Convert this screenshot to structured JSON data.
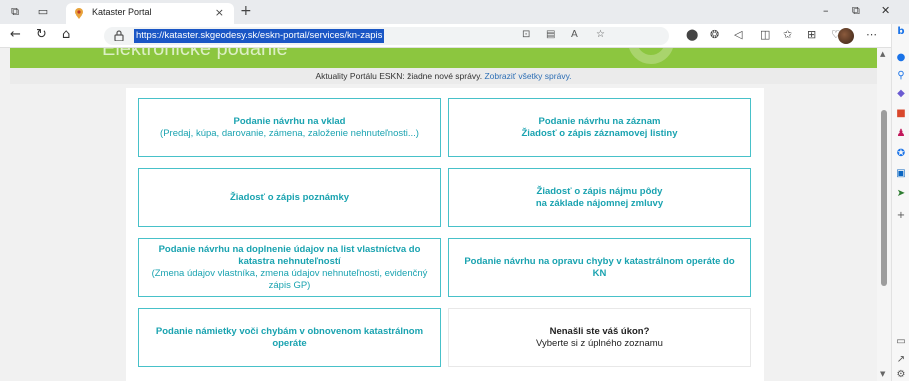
{
  "browser": {
    "tab_title": "Kataster Portal",
    "tab_close": "×",
    "new_tab": "+",
    "url": "https://kataster.skgeodesy.sk/eskn-portal/services/kn-zapis",
    "window_controls": [
      "–",
      "⧉",
      "✕"
    ]
  },
  "page": {
    "banner_title": "Elektronické podanie",
    "news_text": "Aktuality Portálu ESKN: žiadne nové správy.",
    "news_link": "Zobraziť všetky správy."
  },
  "services": {
    "s1_title": "Podanie návrhu na vklad",
    "s1_sub": "(Predaj, kúpa, darovanie, zámena, založenie nehnuteľnosti...)",
    "s2_line1": "Podanie návrhu na záznam",
    "s2_line2": "Žiadosť o zápis záznamovej listiny",
    "s3_title": "Žiadosť o zápis poznámky",
    "s4_line1": "Žiadosť o zápis nájmu pôdy",
    "s4_line2": "na základe nájomnej zmluvy",
    "s5_title": "Podanie návrhu na doplnenie údajov na list vlastníctva do katastra nehnuteľností",
    "s5_sub": "(Zmena údajov vlastníka, zmena údajov nehnuteľnosti, evidenčný zápis GP)",
    "s6_title": "Podanie návrhu na opravu chyby v katastrálnom operáte do KN",
    "s7_title": "Podanie námietky voči chybám v obnovenom katastrálnom operáte",
    "s8_title": "Nenašli ste váš úkon?",
    "s8_sub": "Vyberte si z úplného zoznamu"
  },
  "colors": {
    "banner_green": "#8cc63f",
    "service_teal": "#1aa3b0",
    "box_border": "#47c1c9",
    "url_highlight": "#1a56c5"
  }
}
